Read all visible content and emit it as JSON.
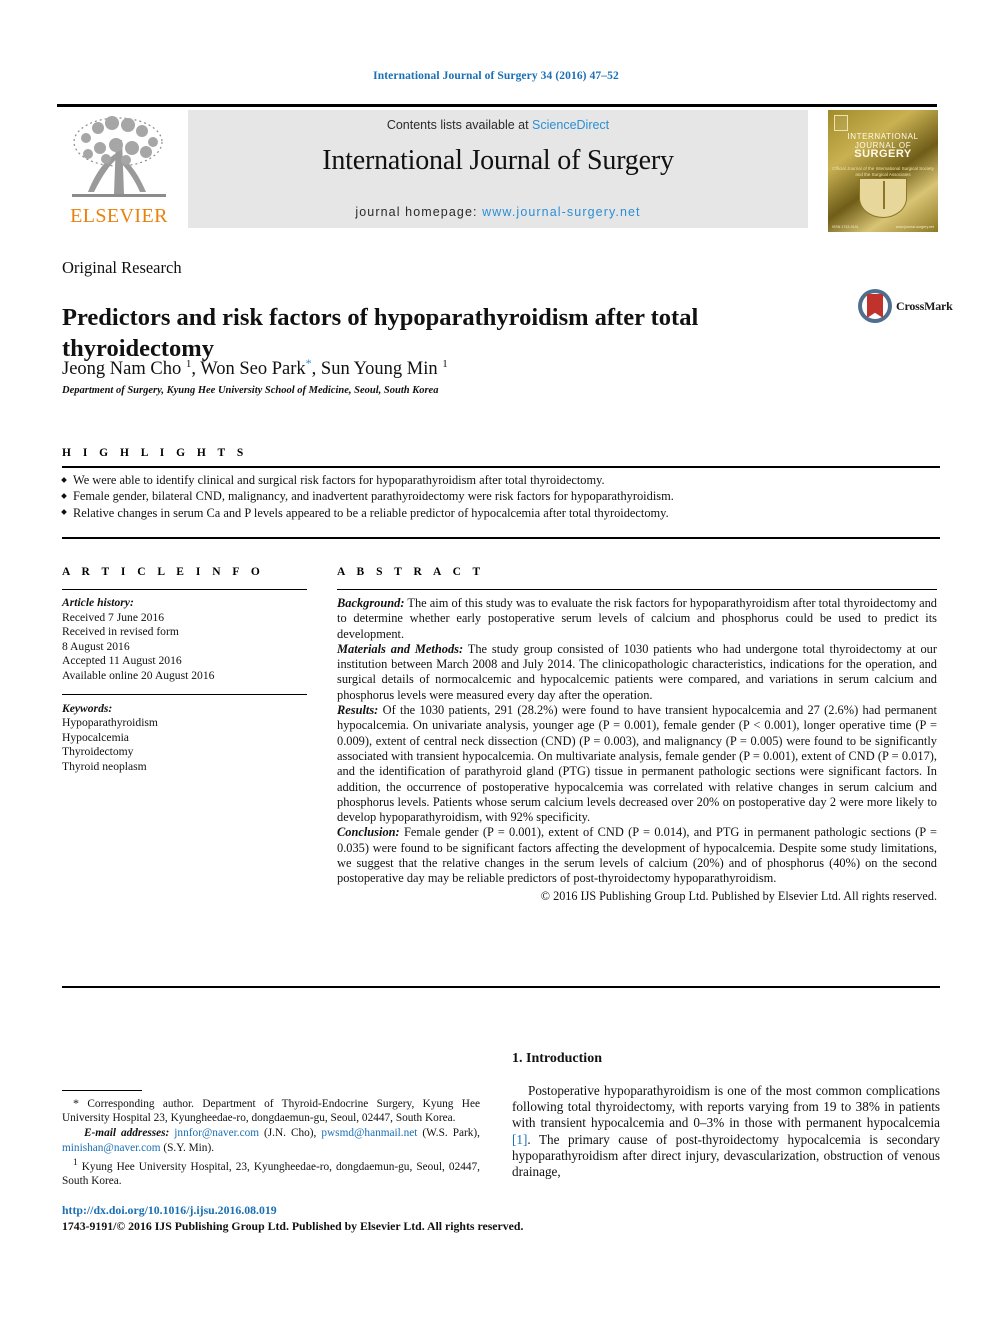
{
  "running_head": "International Journal of Surgery 34 (2016) 47–52",
  "header": {
    "contents_prefix": "Contents lists available at ",
    "sciencedirect": "ScienceDirect",
    "journal_name": "International Journal of Surgery",
    "homepage_label": "journal homepage: ",
    "homepage_url": "www.journal-surgery.net",
    "elsevier_wordmark": "ELSEVIER",
    "cover": {
      "line1": "INTERNATIONAL",
      "line2": "JOURNAL OF",
      "line3": "SURGERY",
      "subtitle": "Official Journal of the International Surgical Society and the Surgical Associates",
      "foot_left": "ISSN 1743-9191",
      "foot_right": "www.journal-surgery.net"
    }
  },
  "article": {
    "type": "Original Research",
    "title": "Predictors and risk factors of hypoparathyroidism after total thyroidectomy",
    "authors_html": "Jeong Nam Cho <sup>1</sup>, Won Seo Park<span class=\"star\">*</span>, Sun Young Min <sup>1</sup>",
    "affiliation": "Department of Surgery, Kyung Hee University School of Medicine, Seoul, South Korea",
    "crossmark_label": "CrossMark"
  },
  "sections": {
    "highlights_label": "H I G H L I G H T S",
    "article_info_label": "A R T I C L E   I N F O",
    "abstract_label": "A B S T R A C T"
  },
  "highlights": [
    "We were able to identify clinical and surgical risk factors for hypoparathyroidism after total thyroidectomy.",
    "Female gender, bilateral CND, malignancy, and inadvertent parathyroidectomy were risk factors for hypoparathyroidism.",
    "Relative changes in serum Ca and P levels appeared to be a reliable predictor of hypocalcemia after total thyroidectomy."
  ],
  "article_info": {
    "history_label": "Article history:",
    "history": [
      "Received 7 June 2016",
      "Received in revised form",
      "8 August 2016",
      "Accepted 11 August 2016",
      "Available online 20 August 2016"
    ],
    "keywords_label": "Keywords:",
    "keywords": [
      "Hypoparathyroidism",
      "Hypocalcemia",
      "Thyroidectomy",
      "Thyroid neoplasm"
    ]
  },
  "abstract": {
    "background_label": "Background:",
    "background": " The aim of this study was to evaluate the risk factors for hypoparathyroidism after total thyroidectomy and to determine whether early postoperative serum levels of calcium and phosphorus could be used to predict its development.",
    "methods_label": "Materials and Methods:",
    "methods": " The study group consisted of 1030 patients who had undergone total thyroidectomy at our institution between March 2008 and July 2014. The clinicopathologic characteristics, indications for the operation, and surgical details of normocalcemic and hypocalcemic patients were compared, and variations in serum calcium and phosphorus levels were measured every day after the operation.",
    "results_label": "Results:",
    "results": " Of the 1030 patients, 291 (28.2%) were found to have transient hypocalcemia and 27 (2.6%) had permanent hypocalcemia. On univariate analysis, younger age (P = 0.001), female gender (P < 0.001), longer operative time (P = 0.009), extent of central neck dissection (CND) (P = 0.003), and malignancy (P = 0.005) were found to be significantly associated with transient hypocalcemia. On multivariate analysis, female gender (P = 0.001), extent of CND (P = 0.017), and the identification of parathyroid gland (PTG) tissue in permanent pathologic sections were significant factors. In addition, the occurrence of postoperative hypocalcemia was correlated with relative changes in serum calcium and phosphorus levels. Patients whose serum calcium levels decreased over 20% on postoperative day 2 were more likely to develop hypoparathyroidism, with 92% specificity.",
    "conclusion_label": "Conclusion:",
    "conclusion": " Female gender (P = 0.001), extent of CND (P = 0.014), and PTG in permanent pathologic sections (P = 0.035) were found to be significant factors affecting the development of hypocalcemia. Despite some study limitations, we suggest that the relative changes in the serum levels of calcium (20%) and of phosphorus (40%) on the second postoperative day may be reliable predictors of post-thyroidectomy hypoparathyroidism.",
    "copyright": "© 2016 IJS Publishing Group Ltd. Published by Elsevier Ltd. All rights reserved."
  },
  "footnotes": {
    "corresponding": "Corresponding author. Department of Thyroid-Endocrine Surgery, Kyung Hee University Hospital 23, Kyungheedae-ro, dongdaemun-gu, Seoul, 02447, South Korea.",
    "email_label": "E-mail addresses:",
    "emails": [
      {
        "address": "jnnfor@naver.com",
        "owner": "(J.N. Cho)"
      },
      {
        "address": "pwsmd@hanmail.net",
        "owner": "(W.S. Park)"
      },
      {
        "address": "minishan@naver.com",
        "owner": "(S.Y. Min)."
      }
    ],
    "affiliation_1": "Kyung Hee University Hospital, 23, Kyungheedae-ro, dongdaemun-gu, Seoul, 02447, South Korea.",
    "doi": "http://dx.doi.org/10.1016/j.ijsu.2016.08.019",
    "issn_line": "1743-9191/© 2016 IJS Publishing Group Ltd. Published by Elsevier Ltd. All rights reserved."
  },
  "introduction": {
    "heading": "1. Introduction",
    "paragraph_pre": "Postoperative hypoparathyroidism is one of the most common complications following total thyroidectomy, with reports varying from 19 to 38% in patients with transient hypocalcemia and 0–3% in those with permanent hypocalcemia ",
    "citation": "[1]",
    "paragraph_post": ". The primary cause of post-thyroidectomy hypocalcemia is secondary hypoparathyroidism after direct injury, devascularization, obstruction of venous drainage,"
  },
  "colors": {
    "link": "#1a6fb5",
    "sciencedirect": "#2b8fd4",
    "elsevier_orange": "#e8820c",
    "band_gray": "#e6e6e6"
  }
}
